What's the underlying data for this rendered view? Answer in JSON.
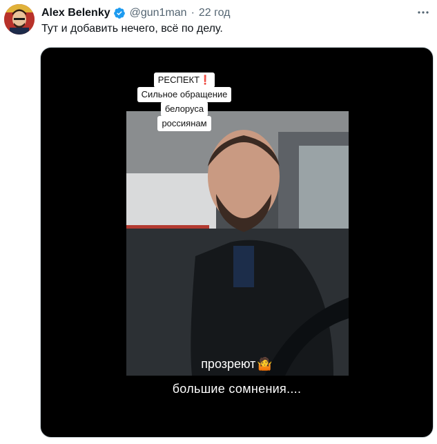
{
  "tweet": {
    "display_name": "Alex Belenky",
    "handle": "@gun1man",
    "separator": "·",
    "time": "22 год",
    "text": "Тут и добавить нечего, всё по делу."
  },
  "media": {
    "caption_lines": [
      "РЕСПЕКТ",
      "Сильное обращение",
      "белоруса",
      "россиянам"
    ],
    "caption_mark": "❗",
    "subtitle_1": "прозреют",
    "subtitle_1_emoji": "🤷",
    "subtitle_2": "большие сомнения...."
  },
  "colors": {
    "verified": "#1d9bf0",
    "secondary_text": "#536471",
    "primary_text": "#0f1419"
  },
  "icons": {
    "verified": "verified-badge-icon",
    "more": "more-options-icon"
  }
}
